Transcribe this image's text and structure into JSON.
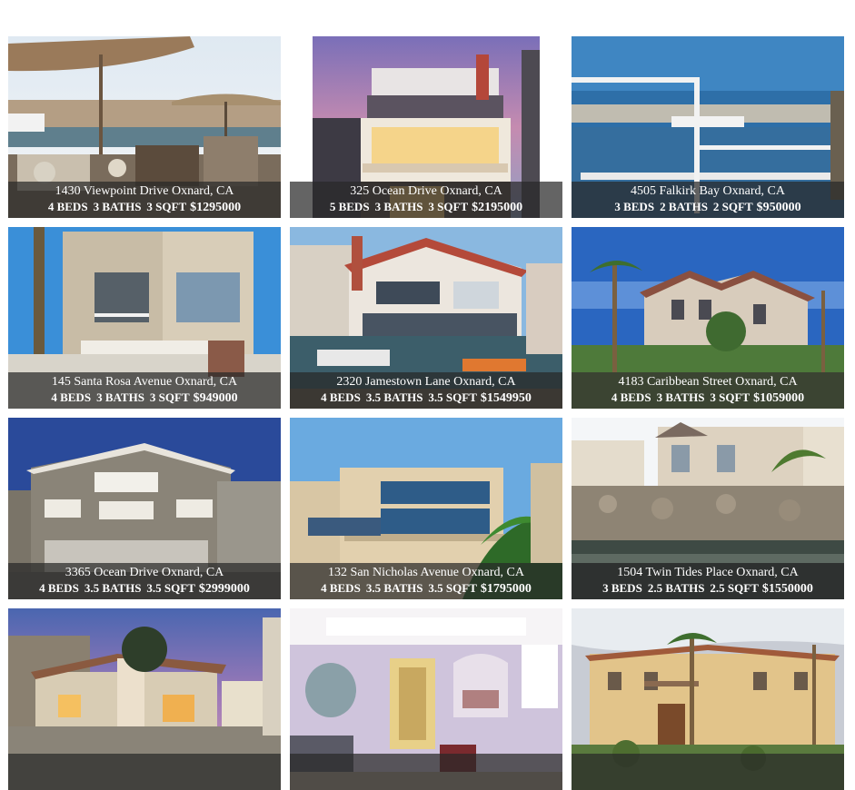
{
  "listings": [
    {
      "address": "1430 Viewpoint Drive Oxnard, CA",
      "beds": "4 BEDS",
      "baths": "3 BATHS",
      "sqft": "3 SQFT",
      "price": "$1295000"
    },
    {
      "address": "325 Ocean Drive Oxnard, CA",
      "beds": "5 BEDS",
      "baths": "3 BATHS",
      "sqft": "3 SQFT",
      "price": "$2195000"
    },
    {
      "address": "4505 Falkirk Bay Oxnard, CA",
      "beds": "3 BEDS",
      "baths": "2 BATHS",
      "sqft": "2 SQFT",
      "price": "$950000"
    },
    {
      "address": "145 Santa Rosa Avenue Oxnard, CA",
      "beds": "4 BEDS",
      "baths": "3 BATHS",
      "sqft": "3 SQFT",
      "price": "$949000"
    },
    {
      "address": "2320 Jamestown Lane Oxnard, CA",
      "beds": "4 BEDS",
      "baths": "3.5 BATHS",
      "sqft": "3.5 SQFT",
      "price": "$1549950"
    },
    {
      "address": "4183 Caribbean Street Oxnard, CA",
      "beds": "4 BEDS",
      "baths": "3 BATHS",
      "sqft": "3 SQFT",
      "price": "$1059000"
    },
    {
      "address": "3365 Ocean Drive Oxnard, CA",
      "beds": "4 BEDS",
      "baths": "3.5 BATHS",
      "sqft": "3.5 SQFT",
      "price": "$2999000"
    },
    {
      "address": "132 San Nicholas Avenue Oxnard, CA",
      "beds": "4 BEDS",
      "baths": "3.5 BATHS",
      "sqft": "3.5 SQFT",
      "price": "$1795000"
    },
    {
      "address": "1504 Twin Tides Place Oxnard, CA",
      "beds": "3 BEDS",
      "baths": "2.5 BATHS",
      "sqft": "2.5 SQFT",
      "price": "$1550000"
    },
    {
      "address": "",
      "beds": "",
      "baths": "",
      "sqft": "",
      "price": ""
    },
    {
      "address": "",
      "beds": "",
      "baths": "",
      "sqft": "",
      "price": ""
    },
    {
      "address": "",
      "beds": "",
      "baths": "",
      "sqft": "",
      "price": ""
    }
  ]
}
